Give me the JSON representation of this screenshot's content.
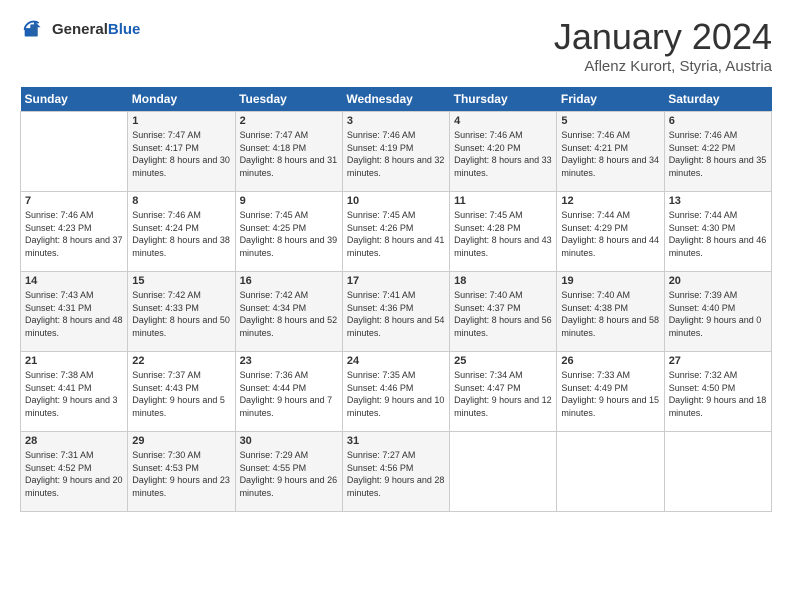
{
  "header": {
    "logo_general": "General",
    "logo_blue": "Blue",
    "month_title": "January 2024",
    "location": "Aflenz Kurort, Styria, Austria"
  },
  "weekdays": [
    "Sunday",
    "Monday",
    "Tuesday",
    "Wednesday",
    "Thursday",
    "Friday",
    "Saturday"
  ],
  "weeks": [
    [
      {
        "day": "",
        "sunrise": "",
        "sunset": "",
        "daylight": ""
      },
      {
        "day": "1",
        "sunrise": "Sunrise: 7:47 AM",
        "sunset": "Sunset: 4:17 PM",
        "daylight": "Daylight: 8 hours and 30 minutes."
      },
      {
        "day": "2",
        "sunrise": "Sunrise: 7:47 AM",
        "sunset": "Sunset: 4:18 PM",
        "daylight": "Daylight: 8 hours and 31 minutes."
      },
      {
        "day": "3",
        "sunrise": "Sunrise: 7:46 AM",
        "sunset": "Sunset: 4:19 PM",
        "daylight": "Daylight: 8 hours and 32 minutes."
      },
      {
        "day": "4",
        "sunrise": "Sunrise: 7:46 AM",
        "sunset": "Sunset: 4:20 PM",
        "daylight": "Daylight: 8 hours and 33 minutes."
      },
      {
        "day": "5",
        "sunrise": "Sunrise: 7:46 AM",
        "sunset": "Sunset: 4:21 PM",
        "daylight": "Daylight: 8 hours and 34 minutes."
      },
      {
        "day": "6",
        "sunrise": "Sunrise: 7:46 AM",
        "sunset": "Sunset: 4:22 PM",
        "daylight": "Daylight: 8 hours and 35 minutes."
      }
    ],
    [
      {
        "day": "7",
        "sunrise": "Sunrise: 7:46 AM",
        "sunset": "Sunset: 4:23 PM",
        "daylight": "Daylight: 8 hours and 37 minutes."
      },
      {
        "day": "8",
        "sunrise": "Sunrise: 7:46 AM",
        "sunset": "Sunset: 4:24 PM",
        "daylight": "Daylight: 8 hours and 38 minutes."
      },
      {
        "day": "9",
        "sunrise": "Sunrise: 7:45 AM",
        "sunset": "Sunset: 4:25 PM",
        "daylight": "Daylight: 8 hours and 39 minutes."
      },
      {
        "day": "10",
        "sunrise": "Sunrise: 7:45 AM",
        "sunset": "Sunset: 4:26 PM",
        "daylight": "Daylight: 8 hours and 41 minutes."
      },
      {
        "day": "11",
        "sunrise": "Sunrise: 7:45 AM",
        "sunset": "Sunset: 4:28 PM",
        "daylight": "Daylight: 8 hours and 43 minutes."
      },
      {
        "day": "12",
        "sunrise": "Sunrise: 7:44 AM",
        "sunset": "Sunset: 4:29 PM",
        "daylight": "Daylight: 8 hours and 44 minutes."
      },
      {
        "day": "13",
        "sunrise": "Sunrise: 7:44 AM",
        "sunset": "Sunset: 4:30 PM",
        "daylight": "Daylight: 8 hours and 46 minutes."
      }
    ],
    [
      {
        "day": "14",
        "sunrise": "Sunrise: 7:43 AM",
        "sunset": "Sunset: 4:31 PM",
        "daylight": "Daylight: 8 hours and 48 minutes."
      },
      {
        "day": "15",
        "sunrise": "Sunrise: 7:42 AM",
        "sunset": "Sunset: 4:33 PM",
        "daylight": "Daylight: 8 hours and 50 minutes."
      },
      {
        "day": "16",
        "sunrise": "Sunrise: 7:42 AM",
        "sunset": "Sunset: 4:34 PM",
        "daylight": "Daylight: 8 hours and 52 minutes."
      },
      {
        "day": "17",
        "sunrise": "Sunrise: 7:41 AM",
        "sunset": "Sunset: 4:36 PM",
        "daylight": "Daylight: 8 hours and 54 minutes."
      },
      {
        "day": "18",
        "sunrise": "Sunrise: 7:40 AM",
        "sunset": "Sunset: 4:37 PM",
        "daylight": "Daylight: 8 hours and 56 minutes."
      },
      {
        "day": "19",
        "sunrise": "Sunrise: 7:40 AM",
        "sunset": "Sunset: 4:38 PM",
        "daylight": "Daylight: 8 hours and 58 minutes."
      },
      {
        "day": "20",
        "sunrise": "Sunrise: 7:39 AM",
        "sunset": "Sunset: 4:40 PM",
        "daylight": "Daylight: 9 hours and 0 minutes."
      }
    ],
    [
      {
        "day": "21",
        "sunrise": "Sunrise: 7:38 AM",
        "sunset": "Sunset: 4:41 PM",
        "daylight": "Daylight: 9 hours and 3 minutes."
      },
      {
        "day": "22",
        "sunrise": "Sunrise: 7:37 AM",
        "sunset": "Sunset: 4:43 PM",
        "daylight": "Daylight: 9 hours and 5 minutes."
      },
      {
        "day": "23",
        "sunrise": "Sunrise: 7:36 AM",
        "sunset": "Sunset: 4:44 PM",
        "daylight": "Daylight: 9 hours and 7 minutes."
      },
      {
        "day": "24",
        "sunrise": "Sunrise: 7:35 AM",
        "sunset": "Sunset: 4:46 PM",
        "daylight": "Daylight: 9 hours and 10 minutes."
      },
      {
        "day": "25",
        "sunrise": "Sunrise: 7:34 AM",
        "sunset": "Sunset: 4:47 PM",
        "daylight": "Daylight: 9 hours and 12 minutes."
      },
      {
        "day": "26",
        "sunrise": "Sunrise: 7:33 AM",
        "sunset": "Sunset: 4:49 PM",
        "daylight": "Daylight: 9 hours and 15 minutes."
      },
      {
        "day": "27",
        "sunrise": "Sunrise: 7:32 AM",
        "sunset": "Sunset: 4:50 PM",
        "daylight": "Daylight: 9 hours and 18 minutes."
      }
    ],
    [
      {
        "day": "28",
        "sunrise": "Sunrise: 7:31 AM",
        "sunset": "Sunset: 4:52 PM",
        "daylight": "Daylight: 9 hours and 20 minutes."
      },
      {
        "day": "29",
        "sunrise": "Sunrise: 7:30 AM",
        "sunset": "Sunset: 4:53 PM",
        "daylight": "Daylight: 9 hours and 23 minutes."
      },
      {
        "day": "30",
        "sunrise": "Sunrise: 7:29 AM",
        "sunset": "Sunset: 4:55 PM",
        "daylight": "Daylight: 9 hours and 26 minutes."
      },
      {
        "day": "31",
        "sunrise": "Sunrise: 7:27 AM",
        "sunset": "Sunset: 4:56 PM",
        "daylight": "Daylight: 9 hours and 28 minutes."
      },
      {
        "day": "",
        "sunrise": "",
        "sunset": "",
        "daylight": ""
      },
      {
        "day": "",
        "sunrise": "",
        "sunset": "",
        "daylight": ""
      },
      {
        "day": "",
        "sunrise": "",
        "sunset": "",
        "daylight": ""
      }
    ]
  ]
}
